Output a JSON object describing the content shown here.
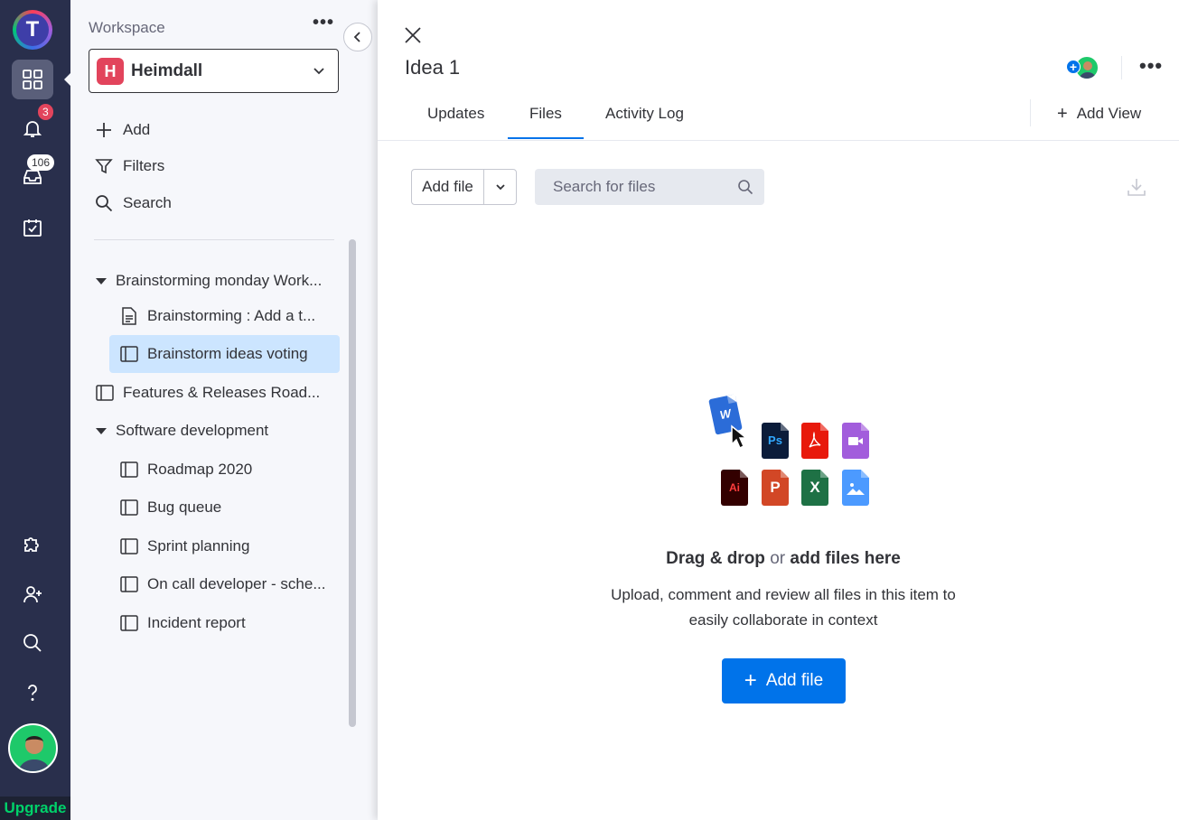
{
  "rail": {
    "logo_letter": "T",
    "notifications_count": "3",
    "inbox_count": "106",
    "upgrade_label": "Upgrade"
  },
  "sidebar": {
    "workspace_label": "Workspace",
    "workspace_letter": "H",
    "workspace_name": "Heimdall",
    "actions": {
      "add": "Add",
      "filters": "Filters",
      "search": "Search"
    },
    "folders": [
      {
        "name": "Brainstorming monday Work...",
        "items": [
          "Brainstorming : Add a t...",
          "Brainstorm ideas voting"
        ]
      },
      {
        "name": "Software development",
        "items": [
          "Roadmap 2020",
          "Bug queue",
          "Sprint planning",
          "On call developer - sche...",
          "Incident report"
        ]
      }
    ],
    "loose_board": "Features & Releases Road..."
  },
  "panel": {
    "title": "Idea 1",
    "tabs": [
      "Updates",
      "Files",
      "Activity Log"
    ],
    "active_tab": "Files",
    "add_view": "Add View",
    "add_file_label": "Add file",
    "search_placeholder": "Search for files",
    "file_types": [
      "W",
      "Ps",
      "PDF",
      "Video",
      "Ai",
      "P",
      "X",
      "Image"
    ],
    "empty_state": {
      "drag": "Drag & drop",
      "or": "or",
      "add": "add files here",
      "line1": "Upload, comment and review all files in this item to",
      "line2": "easily collaborate in context",
      "cta": "Add file"
    }
  },
  "colors": {
    "rail_bg": "#292f4c",
    "primary": "#0073ea",
    "selected_bg": "#cce5ff",
    "badge": "#e2445c",
    "upgrade": "#00d26a"
  }
}
